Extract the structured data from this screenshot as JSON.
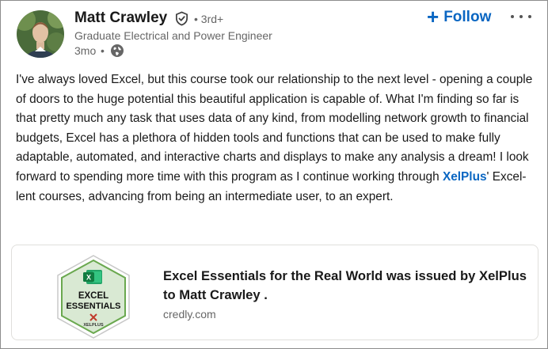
{
  "author": {
    "name": "Matt Crawley",
    "verified_icon": "verified-shield-icon",
    "degree": "• 3rd+",
    "headline": "Graduate Electrical and Power Engineer",
    "timestamp": "3mo",
    "separator": "•",
    "visibility_icon": "globe-icon"
  },
  "actions": {
    "follow_icon": "+",
    "follow_label": "Follow",
    "more_icon": "more-dots-icon"
  },
  "post": {
    "text_before_mention": "I've always loved Excel, but this course took our relationship to the next level - opening a couple of doors to the huge potential this beautiful application is capable of. What I'm finding so far is that pretty much any task that uses data of any kind, from modelling network growth to financial budgets, Excel has a plethora of hidden tools and functions that can be used to make fully adaptable, automated, and interactive charts and displays to make any analysis a dream! I look forward to spending more time with this program as I continue working through ",
    "mention": "XelPlus",
    "text_after_mention": "' Excel-lent courses, advancing from being an intermediate user, to an expert."
  },
  "attachment": {
    "badge_line1": "EXCEL",
    "badge_line2": "ESSENTIALS",
    "badge_brand": "XELPLUS",
    "title": "Excel Essentials for the Real World was issued by XelPlus to Matt Crawley .",
    "source": "credly.com"
  },
  "colors": {
    "accent": "#0a66c2",
    "muted_text": "#666666",
    "excel_green": "#107c41"
  }
}
